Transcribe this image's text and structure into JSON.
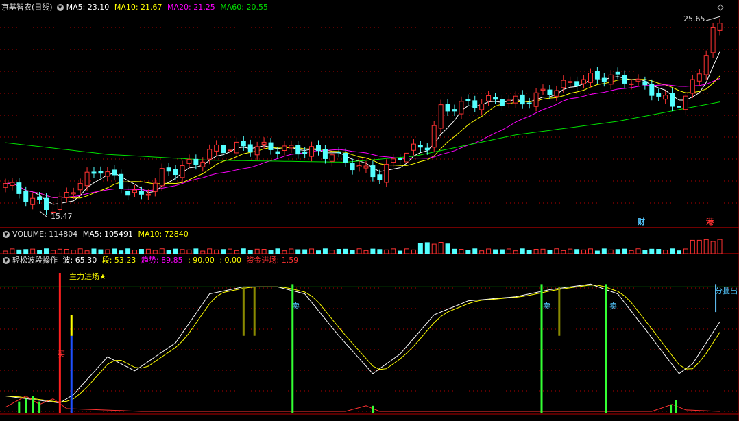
{
  "header": {
    "stock": "京基智农(日线)",
    "ma5": "MA5: 23.10",
    "ma10": "MA10: 21.67",
    "ma20": "MA20: 21.25",
    "ma60": "MA60: 20.55"
  },
  "volume_header": {
    "volume": "VOLUME: 114804",
    "ma5": "MA5: 105491",
    "ma10": "MA10: 72840"
  },
  "indicator_header": {
    "name": "轻松波段操作",
    "bo": "波: 65.30",
    "duan": "段: 53.23",
    "trend": "趋势: 89.85",
    "v90": ": 90.00",
    "v0": ": 0.00",
    "capital": "资金进场: 1.59"
  },
  "annotations": {
    "high": "25.65",
    "low": "15.47",
    "cai": "财",
    "gang": "港",
    "zhuli": "主力进场★",
    "buy": "买",
    "sell": "卖",
    "fenpi": "分批出"
  },
  "colors": {
    "up": "#ff3232",
    "down": "#54ffff",
    "ma5": "#ffffff",
    "ma10": "#ffff00",
    "ma20": "#ff00ff",
    "ma60": "#00e000",
    "grid": "#b40000"
  },
  "chart_data": [
    {
      "type": "candlestick",
      "title": "京基智农(日线)",
      "bars": 106,
      "ylim": [
        15.0,
        26.5
      ],
      "high_marker": 25.65,
      "low_marker": 15.47,
      "ma_lines": [
        "MA5",
        "MA10",
        "MA20",
        "MA60"
      ],
      "ma_last": {
        "MA5": 23.1,
        "MA10": 21.67,
        "MA20": 21.25,
        "MA60": 20.55
      }
    },
    {
      "type": "bar",
      "title": "VOLUME",
      "last": {
        "VOLUME": 114804,
        "MA5": 105491,
        "MA10": 72840
      }
    },
    {
      "type": "line",
      "title": "轻松波段操作",
      "last": {
        "波": 65.3,
        "段": 53.23,
        "趋势": 89.85,
        "level": 90.0,
        "zero": 0.0,
        "资金进场": 1.59
      },
      "ylim": [
        0,
        100
      ]
    }
  ]
}
